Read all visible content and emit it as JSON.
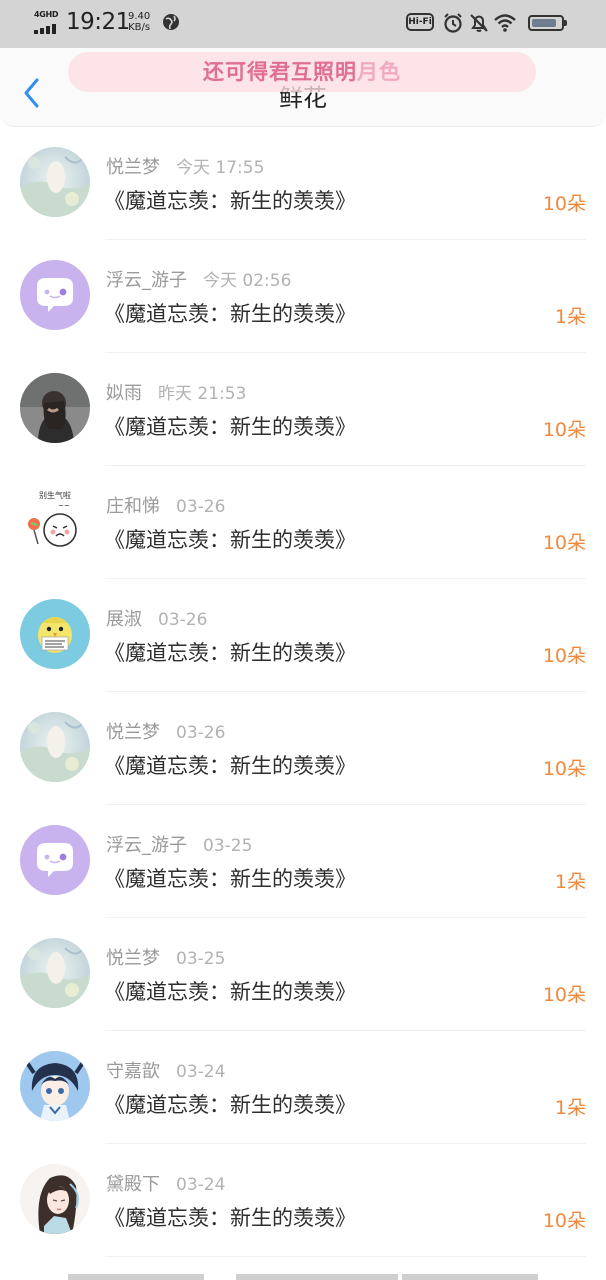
{
  "status_bar": {
    "network": "4GHD",
    "time": "19:21",
    "speed_value": "9.40",
    "speed_unit": "KB/s",
    "hifi": "Hi-Fi",
    "battery_level_pct": 85,
    "icons": [
      "signal-icon",
      "globe-icon",
      "alarm-icon",
      "mute-bell-icon",
      "wifi-icon",
      "battery-icon"
    ]
  },
  "header": {
    "title": "鲜花",
    "banner_text_main": "还可得君互照明",
    "banner_text_fade": "月色",
    "back_icon": "chevron-left-icon"
  },
  "colors": {
    "accent_back": "#2f8ef0",
    "count": "#f0893d",
    "banner": "#e06e92"
  },
  "list": [
    {
      "name": "悦兰梦",
      "time": "今天 17:55",
      "book": "《魔道忘羡：新生的羡羡》",
      "count": "10朵",
      "avatar": "avatar-landscape-icon"
    },
    {
      "name": "浮云_游子",
      "time": "今天 02:56",
      "book": "《魔道忘羡：新生的羡羡》",
      "count": "1朵",
      "avatar": "avatar-chat-bubble-icon"
    },
    {
      "name": "姒雨",
      "time": "昨天 21:53",
      "book": "《魔道忘羡：新生的羡羡》",
      "count": "10朵",
      "avatar": "avatar-girl-photo-icon"
    },
    {
      "name": "庄和悌",
      "time": "03-26",
      "book": "《魔道忘羡：新生的羡羡》",
      "count": "10朵",
      "avatar": "avatar-sticker-icon"
    },
    {
      "name": "展淑",
      "time": "03-26",
      "book": "《魔道忘羡：新生的羡羡》",
      "count": "10朵",
      "avatar": "avatar-yellow-bird-icon"
    },
    {
      "name": "悦兰梦",
      "time": "03-26",
      "book": "《魔道忘羡：新生的羡羡》",
      "count": "10朵",
      "avatar": "avatar-landscape-icon"
    },
    {
      "name": "浮云_游子",
      "time": "03-25",
      "book": "《魔道忘羡：新生的羡羡》",
      "count": "1朵",
      "avatar": "avatar-chat-bubble-icon"
    },
    {
      "name": "悦兰梦",
      "time": "03-25",
      "book": "《魔道忘羡：新生的羡羡》",
      "count": "10朵",
      "avatar": "avatar-landscape-icon"
    },
    {
      "name": "守嘉歆",
      "time": "03-24",
      "book": "《魔道忘羡：新生的羡羡》",
      "count": "1朵",
      "avatar": "avatar-anime-boy-icon"
    },
    {
      "name": "黛殿下",
      "time": "03-24",
      "book": "《魔道忘羡：新生的羡羡》",
      "count": "10朵",
      "avatar": "avatar-anime-lady-icon"
    }
  ]
}
